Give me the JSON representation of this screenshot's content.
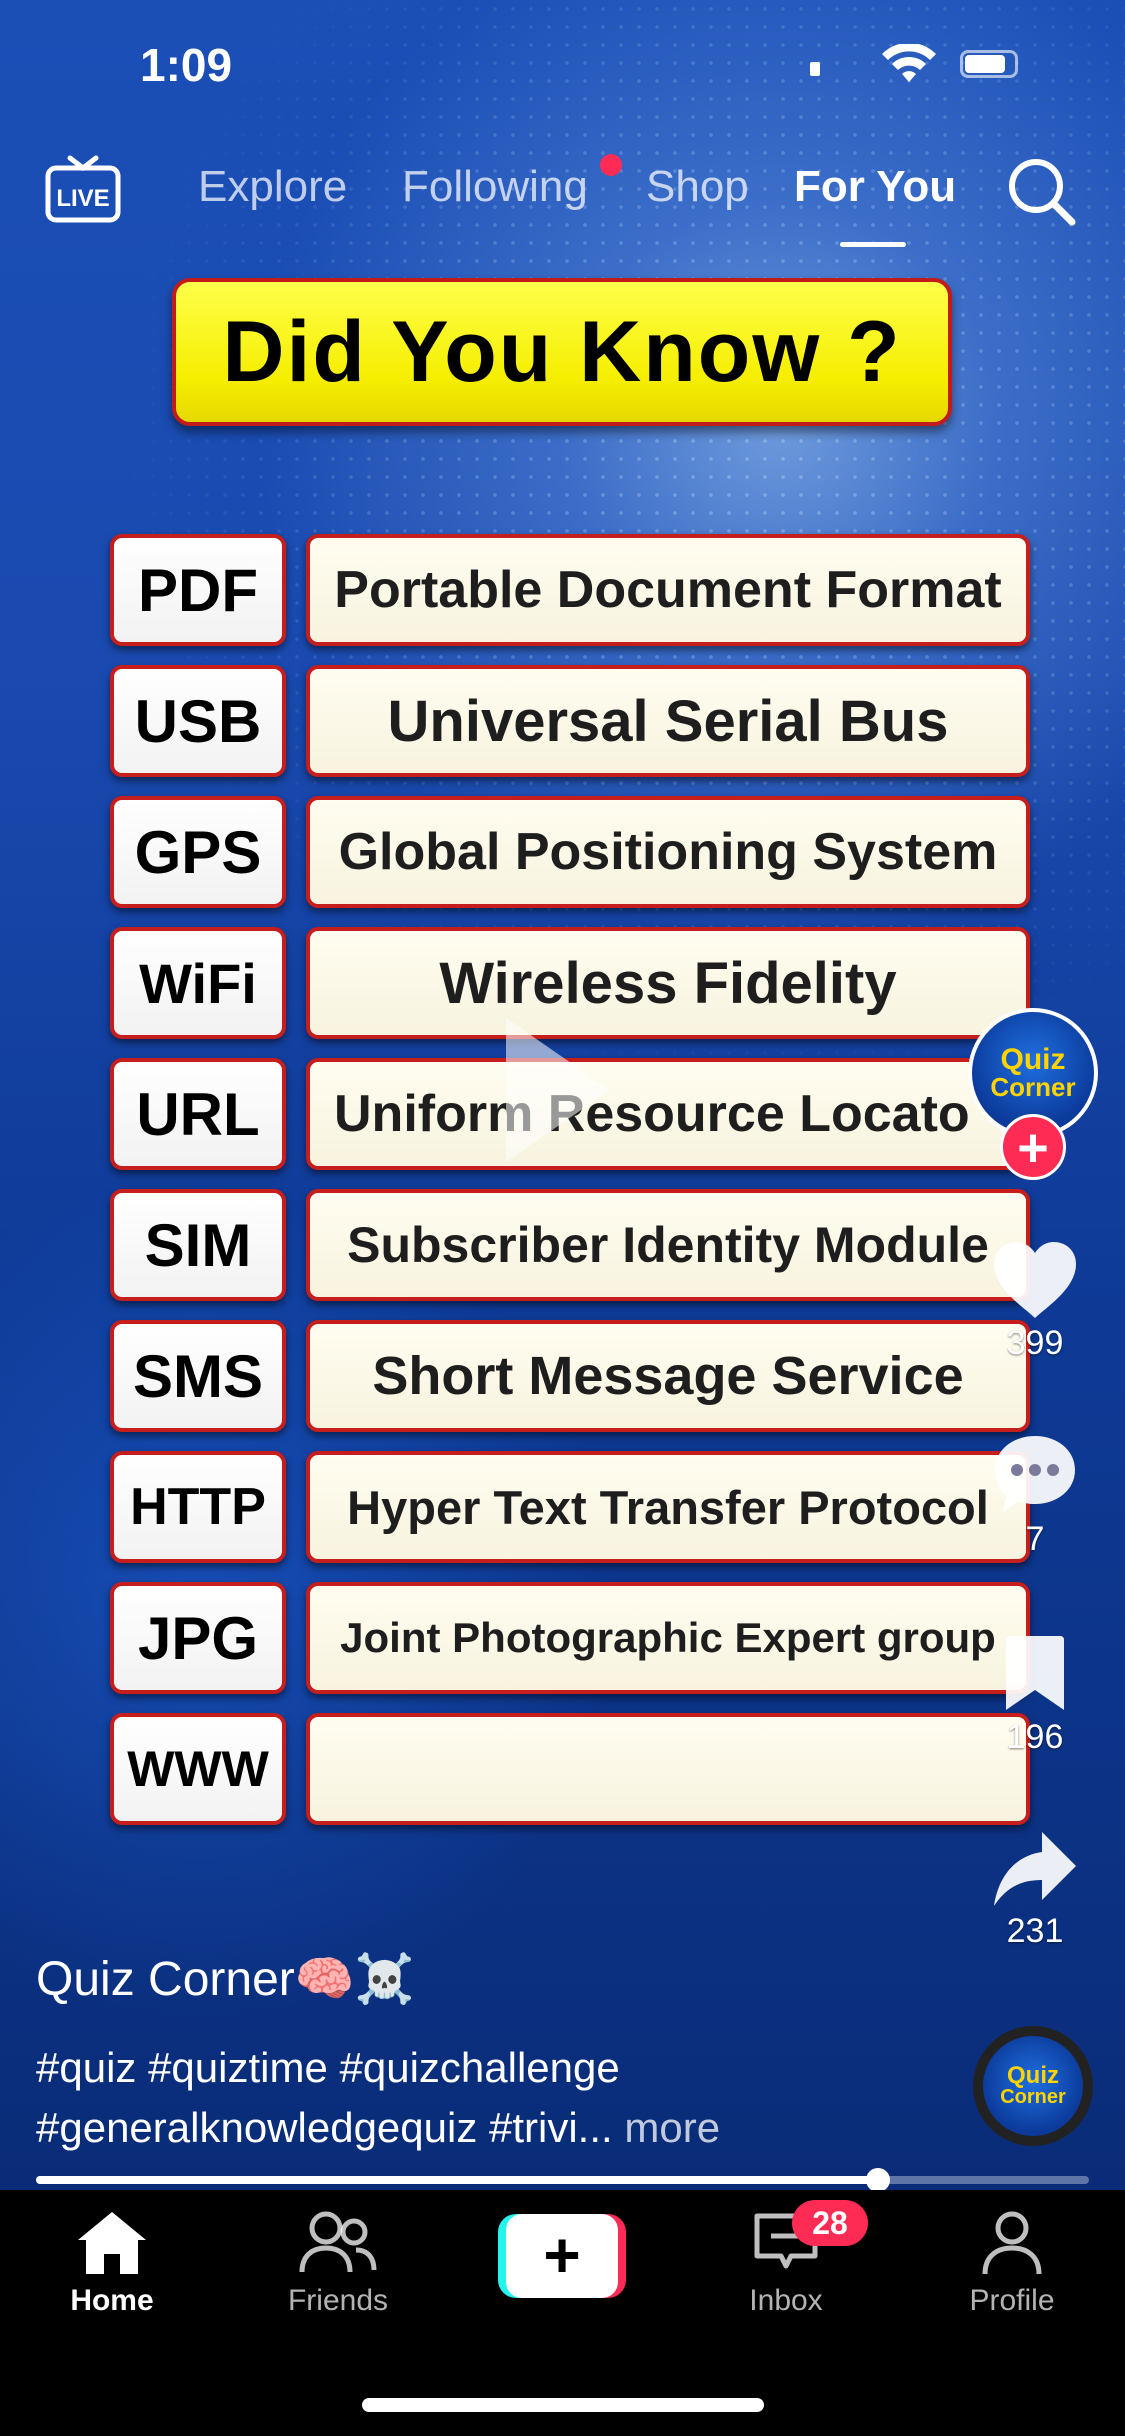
{
  "status_bar": {
    "time": "1:09"
  },
  "top_nav": {
    "live_label": "LIVE",
    "tabs": [
      "Explore",
      "Following",
      "Shop",
      "For You"
    ],
    "active_tab": "For You"
  },
  "video": {
    "title": "Did You Know ?",
    "rows": [
      {
        "abbr": "PDF",
        "full": "Portable Document Format"
      },
      {
        "abbr": "USB",
        "full": "Universal Serial Bus"
      },
      {
        "abbr": "GPS",
        "full": "Global Positioning System"
      },
      {
        "abbr": "WiFi",
        "full": "Wireless Fidelity"
      },
      {
        "abbr": "URL",
        "full": "Uniform Resource Locato"
      },
      {
        "abbr": "SIM",
        "full": "Subscriber Identity Module"
      },
      {
        "abbr": "SMS",
        "full": "Short Message Service"
      },
      {
        "abbr": "HTTP",
        "full": "Hyper Text Transfer Protocol"
      },
      {
        "abbr": "JPG",
        "full": "Joint Photographic Expert group"
      },
      {
        "abbr": "WWW",
        "full": ""
      }
    ]
  },
  "rail": {
    "avatar_text_1": "Quiz",
    "avatar_text_2": "Corner",
    "likes": "399",
    "comments": "7",
    "saves": "196",
    "shares": "231"
  },
  "caption": {
    "author": "Quiz Corner🧠☠️",
    "text": "#quiz #quiztime #quizchallenge #generalknowledgequiz #trivi...",
    "more": "more"
  },
  "progress": {
    "fraction": 0.8
  },
  "bottom_nav": {
    "home": "Home",
    "friends": "Friends",
    "create": "+",
    "inbox": "Inbox",
    "inbox_badge": "28",
    "profile": "Profile"
  },
  "colors": {
    "accent": "#fe2c55",
    "cyan": "#25f4ee",
    "title_yellow": "#f5ee00",
    "border_red": "#c61d1d"
  }
}
